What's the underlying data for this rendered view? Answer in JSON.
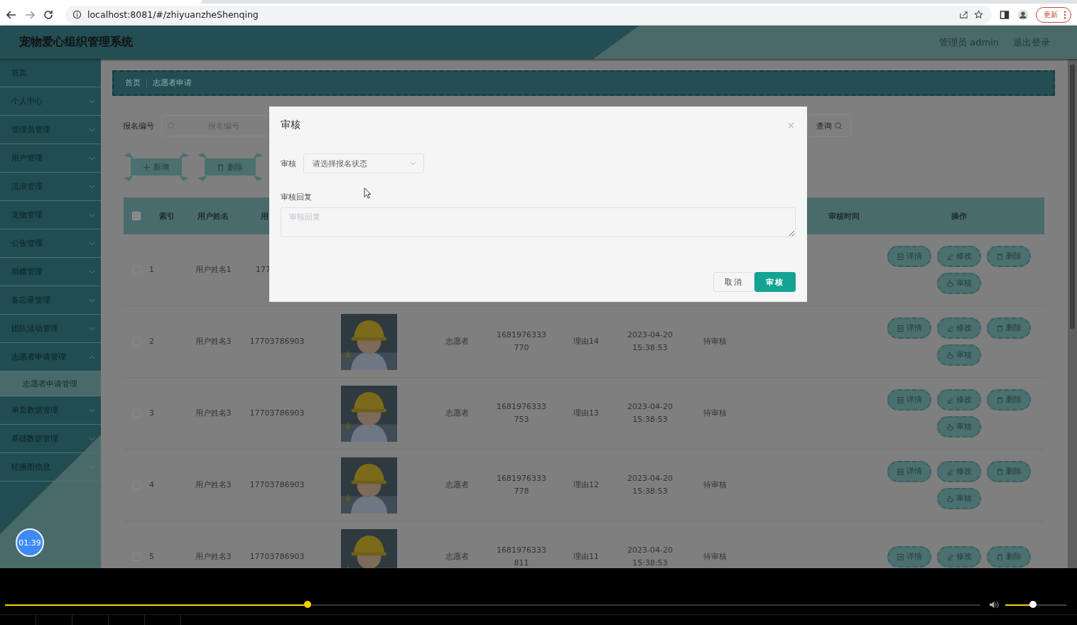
{
  "browser": {
    "url": "localhost:8081/#/zhiyuanzheShenqing",
    "update_button": "更新"
  },
  "header": {
    "title": "宠物爱心组织管理系统",
    "user": "管理员 admin",
    "logout": "退出登录"
  },
  "sidebar": {
    "items": [
      {
        "label": "首页",
        "kind": "link"
      },
      {
        "label": "个人中心",
        "kind": "menu",
        "expanded": false
      },
      {
        "label": "管理员管理",
        "kind": "menu",
        "expanded": false
      },
      {
        "label": "用户管理",
        "kind": "menu",
        "expanded": false
      },
      {
        "label": "流浪管理",
        "kind": "menu",
        "expanded": false
      },
      {
        "label": "宠物管理",
        "kind": "menu",
        "expanded": false
      },
      {
        "label": "公告管理",
        "kind": "menu",
        "expanded": false
      },
      {
        "label": "捐赠管理",
        "kind": "menu",
        "expanded": false
      },
      {
        "label": "备忘录管理",
        "kind": "menu",
        "expanded": false
      },
      {
        "label": "团队活动管理",
        "kind": "menu",
        "expanded": false
      },
      {
        "label": "志愿者申请管理",
        "kind": "menu",
        "expanded": true,
        "children": [
          {
            "label": "志愿者申请管理",
            "selected": true
          }
        ]
      },
      {
        "label": "单页数据管理",
        "kind": "menu",
        "expanded": false
      },
      {
        "label": "基础数据管理",
        "kind": "menu",
        "expanded": false
      },
      {
        "label": "轮播图信息",
        "kind": "menu",
        "expanded": false
      }
    ]
  },
  "timer": "01:39",
  "breadcrumb": [
    "首页",
    "志愿者申请"
  ],
  "search": {
    "label": "报名编号",
    "placeholder": "报名编号",
    "button": "查询"
  },
  "toolbar": [
    {
      "label": "新增",
      "kind": "add"
    },
    {
      "label": "删除",
      "kind": "delete"
    }
  ],
  "table": {
    "all_checked": false,
    "columns": [
      {
        "label": "索引"
      },
      {
        "label": "用户姓名"
      },
      {
        "label": "用"
      },
      {
        "label": "审核时间"
      },
      {
        "label": "操作"
      }
    ],
    "rows": [
      {
        "index": "1",
        "checked": false,
        "name": "用户姓名1",
        "phone": "177",
        "actions": [
          {
            "label": "详情",
            "kind": "detail"
          },
          {
            "label": "修改",
            "kind": "edit"
          },
          {
            "label": "删除",
            "kind": "delete"
          },
          {
            "label": "审核",
            "kind": "audit"
          }
        ]
      },
      {
        "index": "2",
        "checked": false,
        "name": "用户姓名3",
        "phone": "17703786903",
        "photo": {
          "kind": "picture"
        },
        "role": "志愿者",
        "number": "1681976333770",
        "reason": "理由14",
        "date": "2023-04-20 15:38:53",
        "status": "待审核",
        "actions": [
          {
            "label": "详情",
            "kind": "detail"
          },
          {
            "label": "修改",
            "kind": "edit"
          },
          {
            "label": "删除",
            "kind": "delete"
          },
          {
            "label": "审核",
            "kind": "audit"
          }
        ]
      },
      {
        "index": "3",
        "checked": false,
        "name": "用户姓名3",
        "phone": "17703786903",
        "photo": {
          "kind": "picture"
        },
        "role": "志愿者",
        "number": "1681976333753",
        "reason": "理由13",
        "date": "2023-04-20 15:38:53",
        "status": "待审核",
        "actions": [
          {
            "label": "详情",
            "kind": "detail"
          },
          {
            "label": "修改",
            "kind": "edit"
          },
          {
            "label": "删除",
            "kind": "delete"
          },
          {
            "label": "审核",
            "kind": "audit"
          }
        ]
      },
      {
        "index": "4",
        "checked": false,
        "name": "用户姓名3",
        "phone": "17703786903",
        "photo": {
          "kind": "picture"
        },
        "role": "志愿者",
        "number": "1681976333778",
        "reason": "理由12",
        "date": "2023-04-20 15:38:53",
        "status": "待审核",
        "actions": [
          {
            "label": "详情",
            "kind": "detail"
          },
          {
            "label": "修改",
            "kind": "edit"
          },
          {
            "label": "删除",
            "kind": "delete"
          },
          {
            "label": "审核",
            "kind": "audit"
          }
        ]
      },
      {
        "index": "5",
        "checked": false,
        "name": "用户姓名3",
        "phone": "17703786903",
        "photo": {
          "kind": "picture"
        },
        "role": "志愿者",
        "number": "1681976333811",
        "reason": "理由11",
        "date": "2023-04-20 15:38:53",
        "status": "待审核",
        "actions": [
          {
            "label": "详情",
            "kind": "detail"
          },
          {
            "label": "修改",
            "kind": "edit"
          },
          {
            "label": "删除",
            "kind": "delete"
          }
        ]
      }
    ]
  },
  "dialog": {
    "title": "审核",
    "status_label": "审核",
    "status_placeholder": "请选择报名状态",
    "reply_label": "审核回复",
    "reply_placeholder": "审核回复",
    "cancel": "取消",
    "confirm": "审核"
  },
  "player": {
    "progress": {
      "level": 0.31
    },
    "volume": {
      "level": 0.45
    }
  }
}
